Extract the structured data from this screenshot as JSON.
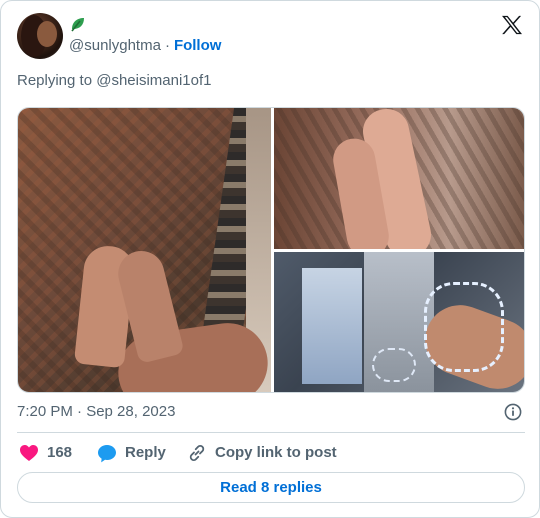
{
  "author": {
    "handle": "@sunlyghtma",
    "follow_label": "Follow",
    "separator": "·"
  },
  "reply_context": "Replying to @sheisimani1of1",
  "media": {
    "count": 3
  },
  "timestamp": "7:20 PM · Sep 28, 2023",
  "actions": {
    "like_count": "168",
    "reply_label": "Reply",
    "copy_label": "Copy link to post"
  },
  "read_replies_label": "Read 8 replies",
  "colors": {
    "accent": "#006fd6",
    "like": "#f91880",
    "reply_icon": "#1d9bf0",
    "muted": "#536471",
    "border": "#cfd9de",
    "badge": "#2e9e4f"
  }
}
